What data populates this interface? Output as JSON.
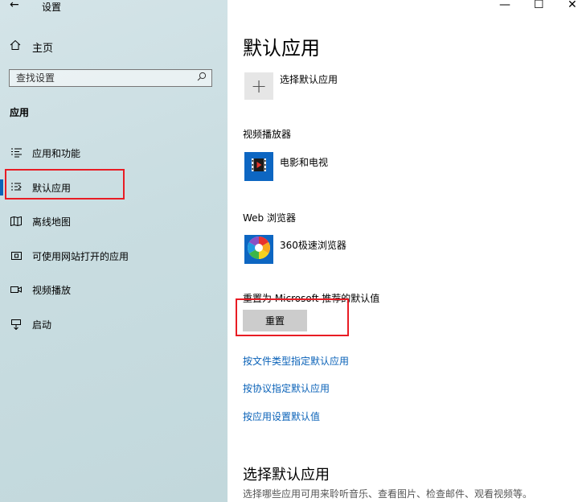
{
  "window": {
    "back_glyph": "←",
    "title": "设置",
    "minimize_glyph": "—",
    "maximize_glyph": "☐",
    "close_glyph": "✕"
  },
  "sidebar": {
    "home": {
      "label": "主页",
      "icon": "home-icon"
    },
    "search": {
      "placeholder": "查找设置",
      "icon": "search-icon"
    },
    "section_title": "应用",
    "items": [
      {
        "label": "应用和功能",
        "icon": "apps-list-icon"
      },
      {
        "label": "默认应用",
        "icon": "default-apps-icon",
        "active": true
      },
      {
        "label": "离线地图",
        "icon": "offline-maps-icon"
      },
      {
        "label": "可使用网站打开的应用",
        "icon": "apps-for-websites-icon"
      },
      {
        "label": "视频播放",
        "icon": "video-playback-icon"
      },
      {
        "label": "启动",
        "icon": "startup-icon"
      }
    ]
  },
  "main": {
    "title": "默认应用",
    "choose_default_label": "选择默认应用",
    "video_player": {
      "category": "视频播放器",
      "app": "电影和电视"
    },
    "web_browser": {
      "category": "Web 浏览器",
      "app": "360极速浏览器"
    },
    "reset": {
      "label": "重置为 Microsoft 推荐的默认值",
      "button": "重置"
    },
    "links": [
      "按文件类型指定默认应用",
      "按协议指定默认应用",
      "按应用设置默认值"
    ],
    "section": {
      "heading": "选择默认应用",
      "description": "选择哪些应用可用来聆听音乐、查看图片、检查邮件、观看视频等。"
    }
  },
  "colors": {
    "accent": "#0a62b8",
    "highlight_box": "#e81c24",
    "sidebar_bg": "#c9dde1"
  }
}
